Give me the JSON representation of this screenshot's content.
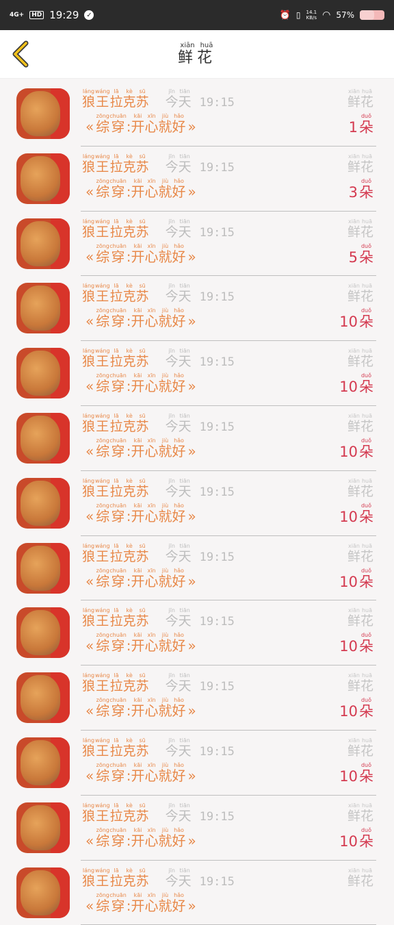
{
  "status_bar": {
    "network": "4G+",
    "hd": "HD",
    "time": "19:29",
    "speed_top": "14.1",
    "speed_bottom": "KB/s",
    "battery": "57%",
    "battery_level": 0.57
  },
  "header": {
    "title": [
      {
        "char": "鲜",
        "pinyin": "xiān"
      },
      {
        "char": "花",
        "pinyin": "huā"
      }
    ]
  },
  "rows": [
    {
      "count": "1",
      "unit": "朵"
    },
    {
      "count": "3",
      "unit": "朵"
    },
    {
      "count": "5",
      "unit": "朵"
    },
    {
      "count": "10",
      "unit": "朵"
    },
    {
      "count": "10",
      "unit": "朵"
    },
    {
      "count": "10",
      "unit": "朵"
    },
    {
      "count": "10",
      "unit": "朵"
    },
    {
      "count": "10",
      "unit": "朵"
    },
    {
      "count": "10",
      "unit": "朵"
    },
    {
      "count": "10",
      "unit": "朵"
    },
    {
      "count": "10",
      "unit": "朵"
    },
    {
      "count": "10",
      "unit": "朵"
    },
    {
      "count": "",
      "unit": ""
    }
  ],
  "row_common": {
    "name": [
      {
        "char": "狼",
        "pinyin": "láng"
      },
      {
        "char": "王",
        "pinyin": "wáng"
      },
      {
        "char": "拉",
        "pinyin": "lā"
      },
      {
        "char": "克",
        "pinyin": "kè"
      },
      {
        "char": "苏",
        "pinyin": "sū"
      }
    ],
    "today": [
      {
        "char": "今",
        "pinyin": "jīn"
      },
      {
        "char": "天",
        "pinyin": "tiān"
      }
    ],
    "time": "19:15",
    "quote_open": "«",
    "quote_close": "»",
    "work": [
      {
        "char": "综",
        "pinyin": "zōng"
      },
      {
        "char": "穿",
        "pinyin": "chuān"
      },
      {
        "char": ":",
        "pinyin": ""
      },
      {
        "char": "开",
        "pinyin": "kāi"
      },
      {
        "char": "心",
        "pinyin": "xīn"
      },
      {
        "char": "就",
        "pinyin": "jiù"
      },
      {
        "char": "好",
        "pinyin": "hǎo"
      }
    ],
    "flower": [
      {
        "char": "鲜",
        "pinyin": "xiān"
      },
      {
        "char": "花",
        "pinyin": "huā"
      }
    ],
    "unit_pinyin": "duǒ"
  }
}
